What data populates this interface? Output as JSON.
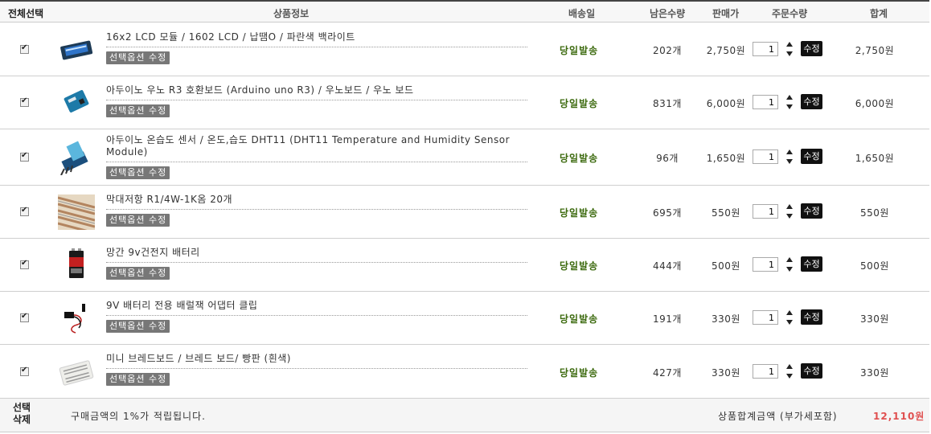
{
  "header": {
    "select_all": "전체선택",
    "product_info": "상품정보",
    "ship_date": "배송일",
    "stock_left": "남은수량",
    "price": "판매가",
    "order_qty": "주문수량",
    "total": "합계"
  },
  "items": [
    {
      "name": "16x2 LCD 모듈 / 1602 LCD / 납땜O / 파란색 백라이트",
      "option_button": "선택옵션 수정",
      "ship": "당일발송",
      "stock": "202개",
      "price": "2,750원",
      "qty": "1",
      "modify": "수정",
      "total": "2,750원",
      "icon": "lcd-module-icon",
      "checked": true
    },
    {
      "name": "아두이노 우노 R3 호환보드 (Arduino uno R3) / 우노보드 / 우노 보드",
      "option_button": "선택옵션 수정",
      "ship": "당일발송",
      "stock": "831개",
      "price": "6,000원",
      "qty": "1",
      "modify": "수정",
      "total": "6,000원",
      "icon": "arduino-board-icon",
      "checked": true
    },
    {
      "name": "아두이노 온습도 센서 / 온도,습도 DHT11 (DHT11 Temperature and Humidity Sensor Module)",
      "option_button": "선택옵션 수정",
      "ship": "당일발송",
      "stock": "96개",
      "price": "1,650원",
      "qty": "1",
      "modify": "수정",
      "total": "1,650원",
      "icon": "dht11-sensor-icon",
      "checked": true
    },
    {
      "name": "막대저항 R1/4W-1K옴 20개",
      "option_button": "선택옵션 수정",
      "ship": "당일발송",
      "stock": "695개",
      "price": "550원",
      "qty": "1",
      "modify": "수정",
      "total": "550원",
      "icon": "resistor-icon",
      "checked": true
    },
    {
      "name": "망간 9v건전지 배터리",
      "option_button": "선택옵션 수정",
      "ship": "당일발송",
      "stock": "444개",
      "price": "500원",
      "qty": "1",
      "modify": "수정",
      "total": "500원",
      "icon": "battery-icon",
      "checked": true
    },
    {
      "name": "9V 배터리 전용 배럴잭 어댑터 클립",
      "option_button": "선택옵션 수정",
      "ship": "당일발송",
      "stock": "191개",
      "price": "330원",
      "qty": "1",
      "modify": "수정",
      "total": "330원",
      "icon": "battery-clip-icon",
      "checked": true
    },
    {
      "name": "미니 브레드보드 / 브레드 보드/ 빵판 (흰색)",
      "option_button": "선택옵션 수정",
      "ship": "당일발송",
      "stock": "427개",
      "price": "330원",
      "qty": "1",
      "modify": "수정",
      "total": "330원",
      "icon": "breadboard-icon",
      "checked": true
    }
  ],
  "footer": {
    "delete_selected": "선택\n삭제",
    "points_note": "구매금액의 1%가 적립됩니다.",
    "sum_label": "상품합계금액 (부가세포함)",
    "sum_value": "12,110원"
  },
  "colors": {
    "ship_text": "#3c6a0e",
    "sum_value": "#e05050",
    "option_button_bg": "#777777",
    "modify_button_bg": "#111111"
  }
}
